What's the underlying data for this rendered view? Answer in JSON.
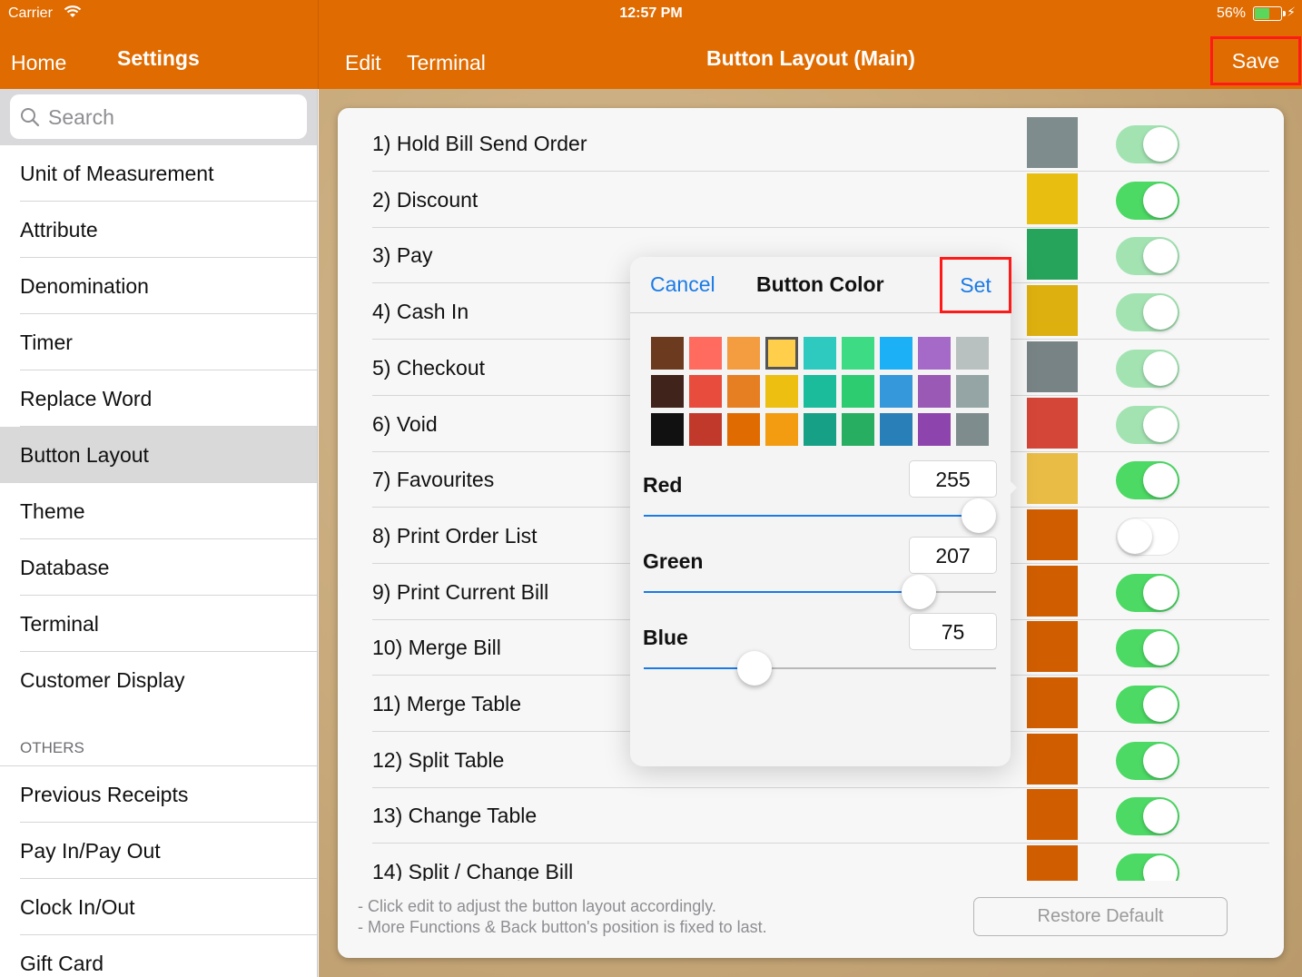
{
  "status_bar": {
    "carrier": "Carrier",
    "time": "12:57 PM",
    "battery": "56%",
    "battery_level": 0.56
  },
  "sidebar_nav": {
    "back_label": "Home",
    "title": "Settings"
  },
  "main_nav": {
    "edit_label": "Edit",
    "terminal_label": "Terminal",
    "title": "Button Layout (Main)",
    "save_label": "Save"
  },
  "search": {
    "placeholder": "Search"
  },
  "sidebar": {
    "items": [
      "Unit of Measurement",
      "Attribute",
      "Denomination",
      "Timer",
      "Replace Word",
      "Button Layout",
      "Theme",
      "Database",
      "Terminal",
      "Customer Display"
    ],
    "selected": "Button Layout",
    "others_header": "OTHERS",
    "others_items": [
      "Previous Receipts",
      "Pay In/Pay Out",
      "Clock In/Out",
      "Gift Card"
    ]
  },
  "buttons": [
    {
      "label": "1) Hold Bill Send Order",
      "color": "#7f8c8d",
      "enabled": true,
      "dim": true
    },
    {
      "label": "2) Discount",
      "color": "#e8be10",
      "enabled": true,
      "dim": false
    },
    {
      "label": "3) Pay",
      "color": "#27a45c",
      "enabled": true,
      "dim": true
    },
    {
      "label": "4) Cash In",
      "color": "#ddb010",
      "enabled": true,
      "dim": true
    },
    {
      "label": "5) Checkout",
      "color": "#788385",
      "enabled": true,
      "dim": true
    },
    {
      "label": "6) Void",
      "color": "#d44638",
      "enabled": true,
      "dim": true
    },
    {
      "label": "7) Favourites",
      "color": "#e8bc45",
      "enabled": true,
      "dim": false
    },
    {
      "label": "8) Print Order List",
      "color": "#d05e00",
      "enabled": false,
      "dim": false
    },
    {
      "label": "9) Print Current Bill",
      "color": "#d05e00",
      "enabled": true,
      "dim": false
    },
    {
      "label": "10) Merge Bill",
      "color": "#d05e00",
      "enabled": true,
      "dim": false
    },
    {
      "label": "11) Merge Table",
      "color": "#d05e00",
      "enabled": true,
      "dim": false
    },
    {
      "label": "12) Split Table",
      "color": "#d05e00",
      "enabled": true,
      "dim": false
    },
    {
      "label": "13) Change Table",
      "color": "#d05e00",
      "enabled": true,
      "dim": false
    },
    {
      "label": "14) Split / Change Bill",
      "color": "#d05e00",
      "enabled": true,
      "dim": false
    }
  ],
  "footnote": {
    "line1": "- Click edit to adjust the button layout accordingly.",
    "line2": "- More Functions & Back button's position is fixed to last."
  },
  "restore_label": "Restore Default",
  "color_picker": {
    "cancel_label": "Cancel",
    "title": "Button Color",
    "set_label": "Set",
    "palette": [
      [
        "#6b3a1f",
        "#ff6b5e",
        "#f39c40",
        "#ffcf4b",
        "#2ecac0",
        "#3ddc84",
        "#1cb0f6",
        "#a56ac8",
        "#b8c0c0"
      ],
      [
        "#40231a",
        "#e74c3c",
        "#e67e22",
        "#ecbf10",
        "#1abc9c",
        "#2ecc71",
        "#3498db",
        "#9b59b6",
        "#95a5a6"
      ],
      [
        "#111111",
        "#c0392b",
        "#e06b00",
        "#f39c12",
        "#16a085",
        "#27ae60",
        "#2980b9",
        "#8e44ad",
        "#7f8c8d"
      ]
    ],
    "selected_swatch": [
      0,
      3
    ],
    "red_label": "Red",
    "red_value": "255",
    "green_label": "Green",
    "green_value": "207",
    "blue_label": "Blue",
    "blue_value": "75"
  }
}
